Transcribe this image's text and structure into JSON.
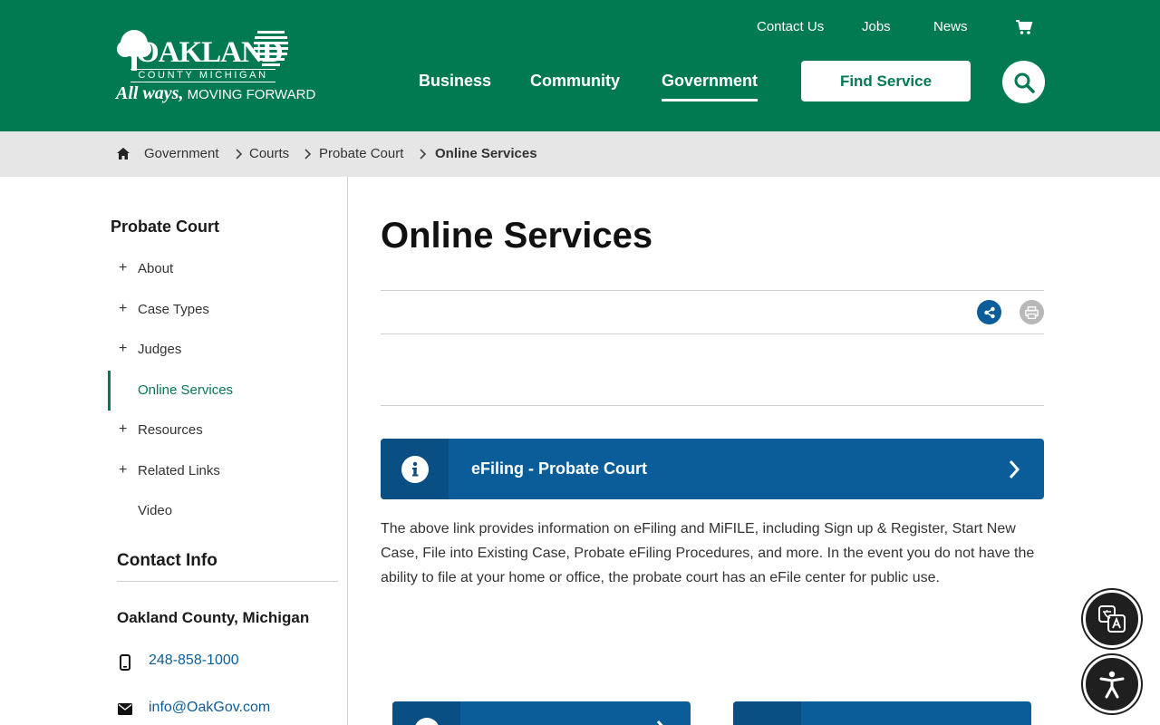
{
  "header": {
    "logo": {
      "word": "OAKLAND",
      "sub": "COUNTY MICHIGAN",
      "tagline_script": "All ways,",
      "tagline_plain": " MOVING FORWARD"
    },
    "utility_nav": [
      "Contact Us",
      "Jobs",
      "News"
    ],
    "main_nav": [
      "Business",
      "Community",
      "Government"
    ],
    "active_nav": "Government",
    "find_service_label": "Find Service"
  },
  "breadcrumb": {
    "items": [
      "Government",
      "Courts",
      "Probate Court"
    ],
    "current": "Online Services"
  },
  "sidebar": {
    "title": "Probate Court",
    "items": [
      {
        "label": "About",
        "expandable": true
      },
      {
        "label": "Case Types",
        "expandable": true
      },
      {
        "label": "Judges",
        "expandable": true
      },
      {
        "label": "Online Services",
        "expandable": false,
        "active": true
      },
      {
        "label": "Resources",
        "expandable": true
      },
      {
        "label": "Related Links",
        "expandable": true
      },
      {
        "label": "Video",
        "expandable": false
      }
    ],
    "expand_symbol": "+",
    "contact": {
      "title": "Contact Info",
      "org": "Oakland County, Michigan",
      "phone": "248-858-1000",
      "email": "info@OakGov.com"
    }
  },
  "main": {
    "title": "Online Services",
    "efile_card": {
      "label": "eFiling - Probate Court",
      "icon": "info-icon"
    },
    "body_text": "The above link provides information on eFiling and MiFILE, including Sign up & Register, Start New Case, File into Existing Case, Probate eFiling Procedures, and more.  In the event you do not have the ability to file at your home or office, the probate court has an eFile center for public use."
  },
  "colors": {
    "brand_green": "#027a51",
    "link_blue": "#0b5d9a",
    "card_blue": "#0b5d9a",
    "breadcrumb_bg": "#e6e6e6"
  },
  "icons": [
    "cart-icon",
    "search-icon",
    "home-icon",
    "chevron-right-icon",
    "share-icon",
    "print-icon",
    "info-icon",
    "phone-icon",
    "mail-icon",
    "translate-icon",
    "accessibility-icon"
  ]
}
